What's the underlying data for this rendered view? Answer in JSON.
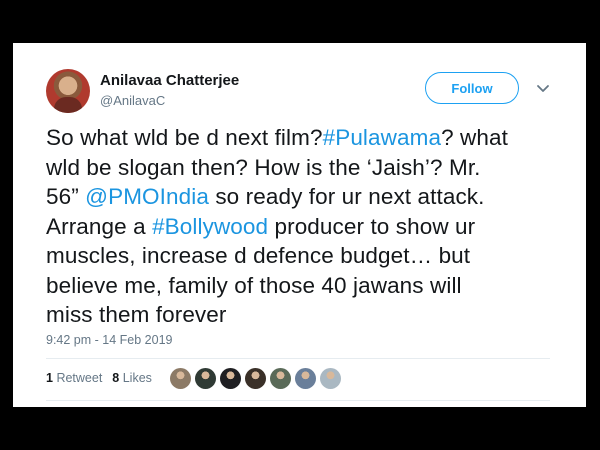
{
  "author": {
    "name": "Anilavaa Chatterjee",
    "handle": "@AnilavaC"
  },
  "follow_label": "Follow",
  "tweet": {
    "lines": [
      [
        {
          "t": "So what wld be d next film?"
        },
        {
          "t": "#Pulawama",
          "link": true
        },
        {
          "t": "? what"
        }
      ],
      [
        {
          "t": "wld be slogan then? How is the ‘Jaish’? Mr."
        }
      ],
      [
        {
          "t": "56” "
        },
        {
          "t": "@PMOIndia",
          "link": true
        },
        {
          "t": " so ready for ur next attack."
        }
      ],
      [
        {
          "t": "Arrange a "
        },
        {
          "t": "#Bollywood",
          "link": true
        },
        {
          "t": " producer to show ur"
        }
      ],
      [
        {
          "t": "muscles, increase d defence budget… but"
        }
      ],
      [
        {
          "t": "believe me, family of those 40 jawans will"
        }
      ],
      [
        {
          "t": "miss them forever"
        }
      ]
    ]
  },
  "timestamp": "9:42 pm - 14 Feb 2019",
  "stats": {
    "retweets_count": "1",
    "retweets_label": "Retweet",
    "likes_count": "8",
    "likes_label": "Likes"
  },
  "colors": {
    "link": "#1b95e0",
    "follow": "#1da1f2",
    "text": "#14171a",
    "muted": "#657786"
  },
  "likers": [
    {
      "icon": "liker-avatar-1",
      "color": "#8c7a66"
    },
    {
      "icon": "liker-avatar-2",
      "color": "#2f3a34"
    },
    {
      "icon": "liker-avatar-3",
      "color": "#1f1f22"
    },
    {
      "icon": "liker-avatar-4",
      "color": "#3a3028"
    },
    {
      "icon": "liker-avatar-5",
      "color": "#5a6a58"
    },
    {
      "icon": "liker-avatar-6",
      "color": "#6a7f9a"
    },
    {
      "icon": "liker-avatar-7",
      "color": "#aab8c2"
    }
  ]
}
